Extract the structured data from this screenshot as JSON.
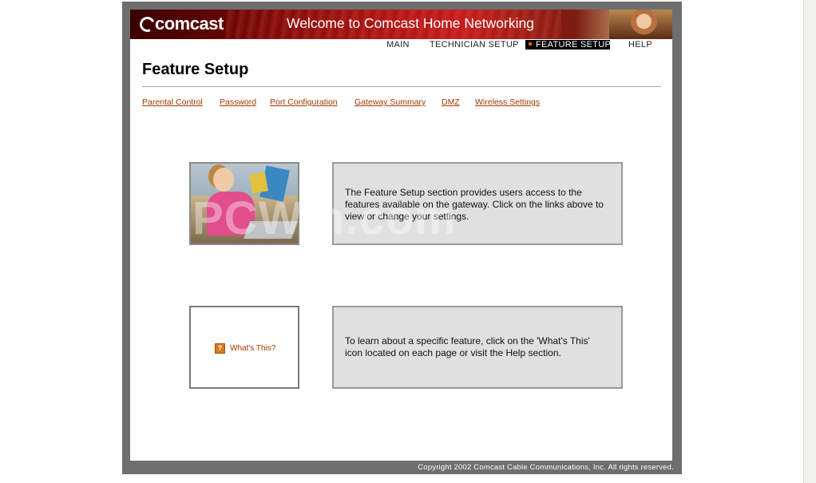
{
  "header": {
    "logo_text": "comcast",
    "title": "Welcome to Comcast Home Networking"
  },
  "nav": {
    "items": [
      "MAIN",
      "TECHNICIAN SETUP",
      "FEATURE SETUP",
      "HELP"
    ],
    "active": "FEATURE SETUP"
  },
  "page": {
    "title": "Feature Setup"
  },
  "sublinks": [
    "Parental Control",
    "Password",
    "Port Configuration",
    "Gateway Summary",
    "DMZ",
    "Wireless Settings"
  ],
  "info": {
    "box1_text": "The Feature Setup section provides users access to the features available on the gateway. Click on the links above to view or change your settings.",
    "box2_text": "To learn about a specific feature, click on the 'What's This' icon located on each page or visit the Help section.",
    "whats_this_label": "What's This?",
    "whats_this_icon": "question-icon"
  },
  "watermark": "PCWin.com",
  "footer": {
    "copyright": "Copyright 2002 Comcast Cable Communications, Inc. All rights reserved."
  },
  "colors": {
    "link": "#a33a00",
    "frame": "#6e6e6e",
    "box_bg": "#e0e0e0",
    "banner_red": "#c41a1a"
  }
}
